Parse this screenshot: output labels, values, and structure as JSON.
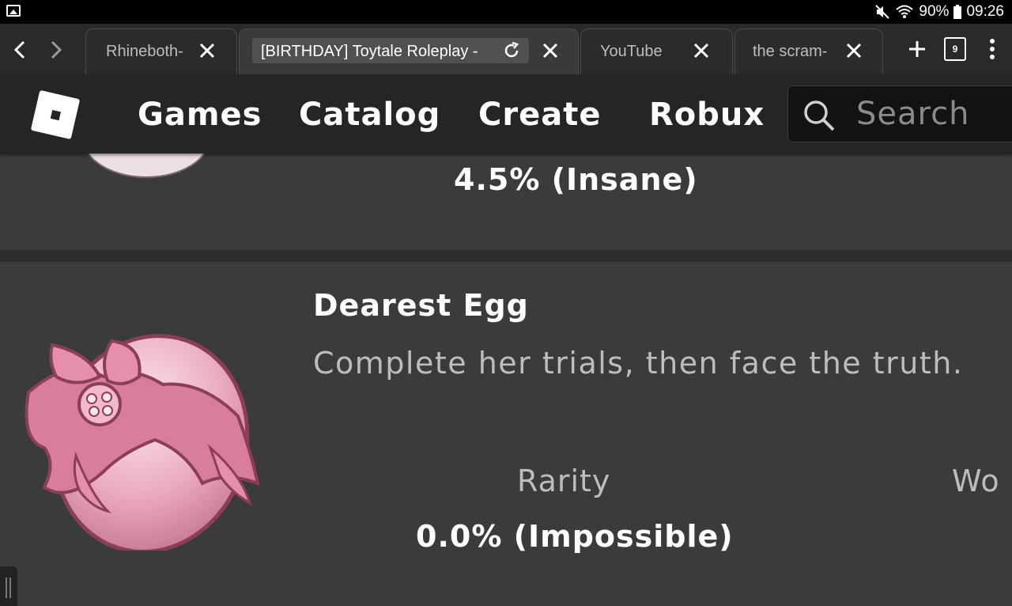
{
  "status_bar": {
    "battery": "90%",
    "time": "09:26",
    "icons": [
      "gallery-icon",
      "mute-icon",
      "wifi-icon",
      "battery-icon"
    ]
  },
  "browser": {
    "tabs": [
      {
        "label": "Rhineboth-",
        "active": false
      },
      {
        "label": "[BIRTHDAY] Toytale Roleplay -",
        "active": true
      },
      {
        "label": "YouTube",
        "active": false
      },
      {
        "label": "the scram-",
        "active": false
      }
    ],
    "tab_count": "9"
  },
  "header": {
    "nav": [
      "Games",
      "Catalog",
      "Create",
      "Robux"
    ],
    "search_placeholder": "Search"
  },
  "previous_badge": {
    "rarity_value": "4.5% (Insane)"
  },
  "badge": {
    "title": "Dearest Egg",
    "description": "Complete her trials, then face the truth.",
    "rarity_label": "Rarity",
    "rarity_value": "0.0% (Impossible)",
    "second_label": "Wo"
  },
  "colors": {
    "page_bg": "#393b3d",
    "header_bg": "#232527",
    "egg_pink": "#e9a9bd",
    "bow_pink": "#d96f93"
  }
}
